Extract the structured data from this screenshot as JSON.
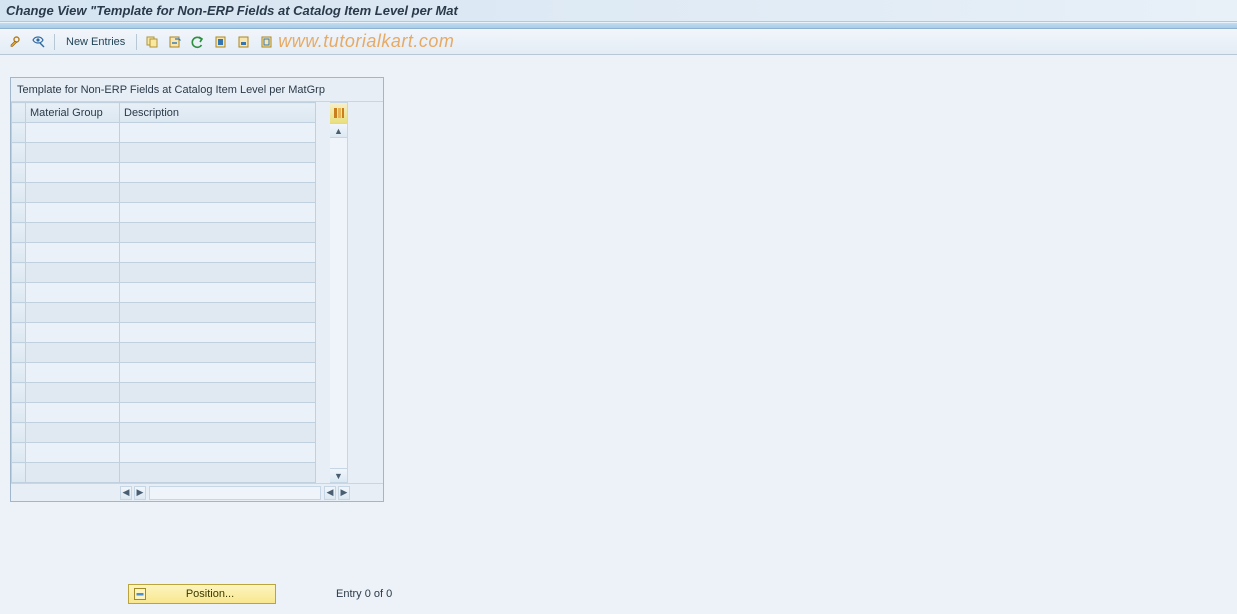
{
  "title": "Change View \"Template for Non-ERP Fields at Catalog Item Level per Mat",
  "watermark": "www.tutorialkart.com",
  "toolbar": {
    "new_entries": "New Entries"
  },
  "table": {
    "panel_title": "Template for Non-ERP Fields at Catalog Item Level per MatGrp",
    "columns": {
      "material_group": "Material Group",
      "description": "Description"
    },
    "rows": [
      {
        "material_group": "",
        "description": ""
      },
      {
        "material_group": "",
        "description": ""
      },
      {
        "material_group": "",
        "description": ""
      },
      {
        "material_group": "",
        "description": ""
      },
      {
        "material_group": "",
        "description": ""
      },
      {
        "material_group": "",
        "description": ""
      },
      {
        "material_group": "",
        "description": ""
      },
      {
        "material_group": "",
        "description": ""
      },
      {
        "material_group": "",
        "description": ""
      },
      {
        "material_group": "",
        "description": ""
      },
      {
        "material_group": "",
        "description": ""
      },
      {
        "material_group": "",
        "description": ""
      },
      {
        "material_group": "",
        "description": ""
      },
      {
        "material_group": "",
        "description": ""
      },
      {
        "material_group": "",
        "description": ""
      },
      {
        "material_group": "",
        "description": ""
      },
      {
        "material_group": "",
        "description": ""
      },
      {
        "material_group": "",
        "description": ""
      }
    ]
  },
  "footer": {
    "position_label": "Position...",
    "entry_text": "Entry 0 of 0"
  }
}
